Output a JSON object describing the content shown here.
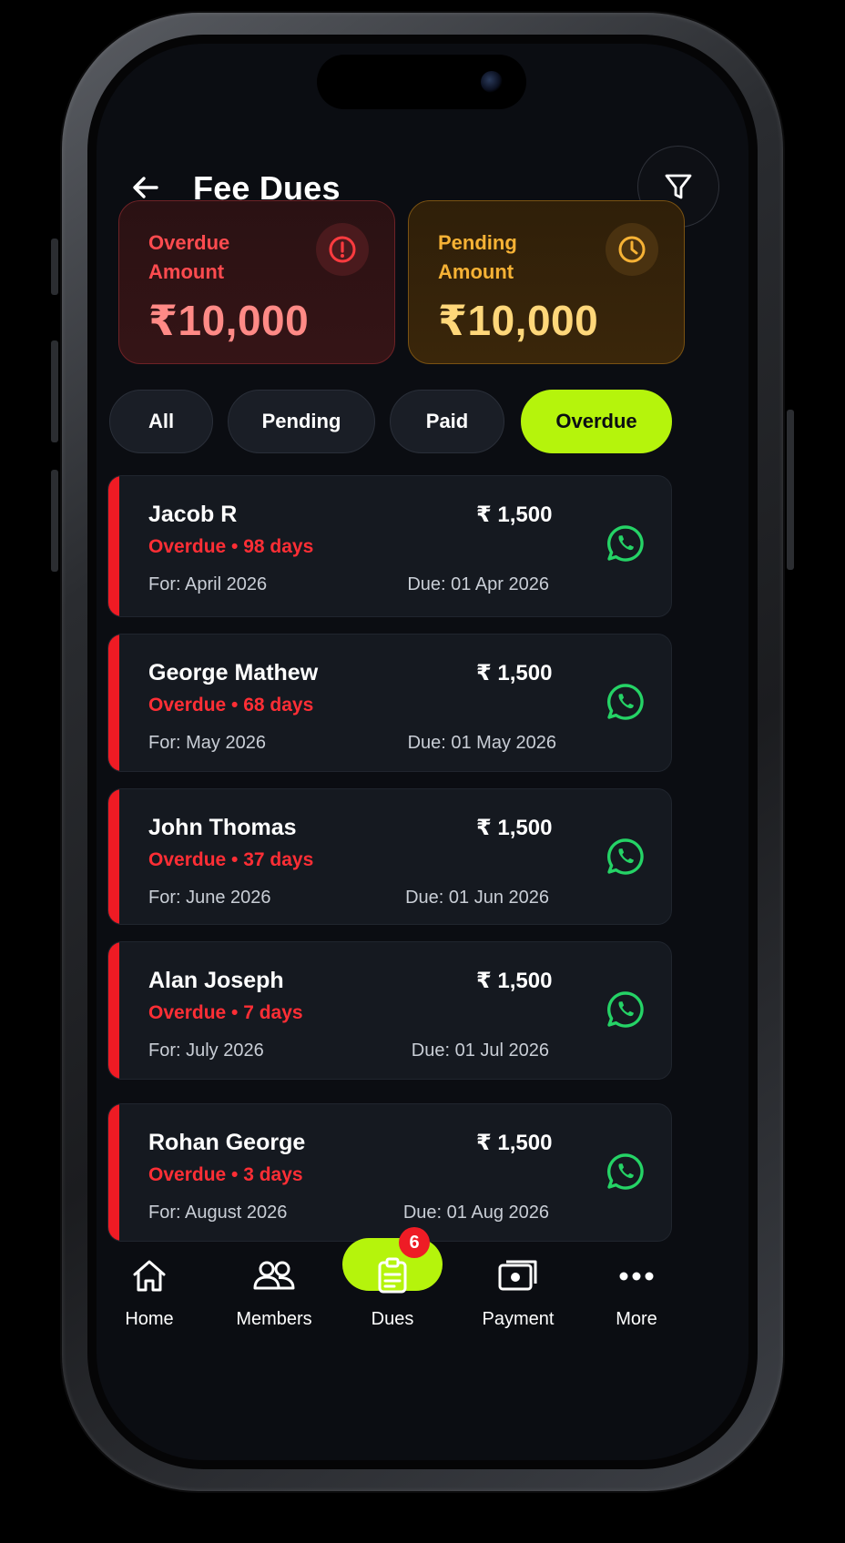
{
  "header": {
    "title": "Fee Dues"
  },
  "summary": {
    "overdue": {
      "label": "Overdue Amount",
      "value": "₹10,000",
      "color": "#ff4b4f"
    },
    "pending": {
      "label": "Pending Amount",
      "value": "₹10,000",
      "color": "#f6b235"
    }
  },
  "filters": [
    {
      "label": "All",
      "active": false
    },
    {
      "label": "Pending",
      "active": false
    },
    {
      "label": "Paid",
      "active": false
    },
    {
      "label": "Overdue",
      "active": true
    }
  ],
  "dues": [
    {
      "name": "Jacob R",
      "amount": "₹ 1,500",
      "status": "Overdue • 98 days",
      "for": "For: April 2026",
      "due": "Due: 01 Apr 2026"
    },
    {
      "name": "George Mathew",
      "amount": "₹ 1,500",
      "status": "Overdue • 68 days",
      "for": "For: May 2026",
      "due": "Due: 01 May 2026"
    },
    {
      "name": "John Thomas",
      "amount": "₹ 1,500",
      "status": "Overdue • 37 days",
      "for": "For: June 2026",
      "due": "Due: 01 Jun 2026"
    },
    {
      "name": "Alan Joseph",
      "amount": "₹ 1,500",
      "status": "Overdue • 7 days",
      "for": "For: July 2026",
      "due": "Due: 01 Jul 2026"
    },
    {
      "name": "Rohan George",
      "amount": "₹ 1,500",
      "status": "Overdue • 3 days",
      "for": "For: August 2026",
      "due": "Due: 01 Aug 2026"
    }
  ],
  "nav": {
    "items": [
      {
        "label": "Home",
        "icon": "home-icon"
      },
      {
        "label": "Members",
        "icon": "members-icon"
      },
      {
        "label": "Dues",
        "icon": "dues-icon",
        "active": true,
        "badge": "6"
      },
      {
        "label": "Payment",
        "icon": "payment-icon"
      },
      {
        "label": "More",
        "icon": "more-icon"
      }
    ]
  },
  "colors": {
    "accent": "#b5f40c",
    "overdue": "#ef1b24",
    "whatsapp": "#25d366",
    "background": "#0b0d12"
  }
}
